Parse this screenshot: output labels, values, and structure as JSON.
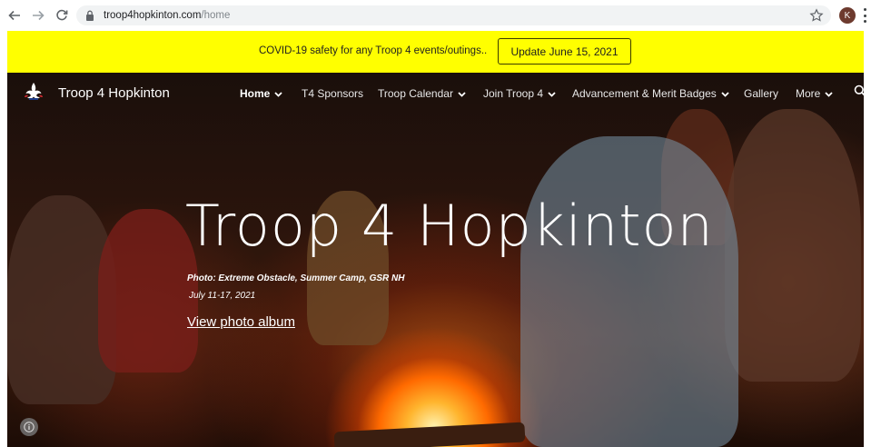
{
  "browser": {
    "url_domain": "troop4hopkinton.com",
    "url_path": "/home",
    "profile_initial": "K"
  },
  "banner": {
    "message": "COVID-19 safety for any Troop 4 events/outings..",
    "button_label": "Update June 15, 2021",
    "background_color": "#ffff00"
  },
  "site": {
    "title": "Troop 4 Hopkinton"
  },
  "nav": {
    "items": [
      {
        "label": "Home",
        "has_dropdown": true,
        "active": true
      },
      {
        "label": "T4 Sponsors",
        "has_dropdown": false,
        "active": false
      },
      {
        "label": "Troop Calendar",
        "has_dropdown": true,
        "active": false
      },
      {
        "label": "Join Troop 4",
        "has_dropdown": true,
        "active": false
      },
      {
        "label": "Advancement & Merit Badges",
        "has_dropdown": true,
        "active": false
      },
      {
        "label": "Gallery",
        "has_dropdown": false,
        "active": false
      },
      {
        "label": "More",
        "has_dropdown": true,
        "active": false
      }
    ]
  },
  "hero": {
    "title": "Troop 4 Hopkinton",
    "caption_line1": "Photo:  Extreme Obstacle, Summer Camp, GSR NH",
    "caption_line2": "July 11-17, 2021",
    "link_label": "View photo album"
  },
  "icons": {
    "back": "arrow-left-icon",
    "forward": "arrow-right-icon",
    "reload": "reload-icon",
    "lock": "lock-icon",
    "star": "star-icon",
    "menu": "kebab-menu-icon",
    "logo": "bsa-fleur-de-lis-icon",
    "search": "search-icon",
    "info": "info-icon"
  }
}
